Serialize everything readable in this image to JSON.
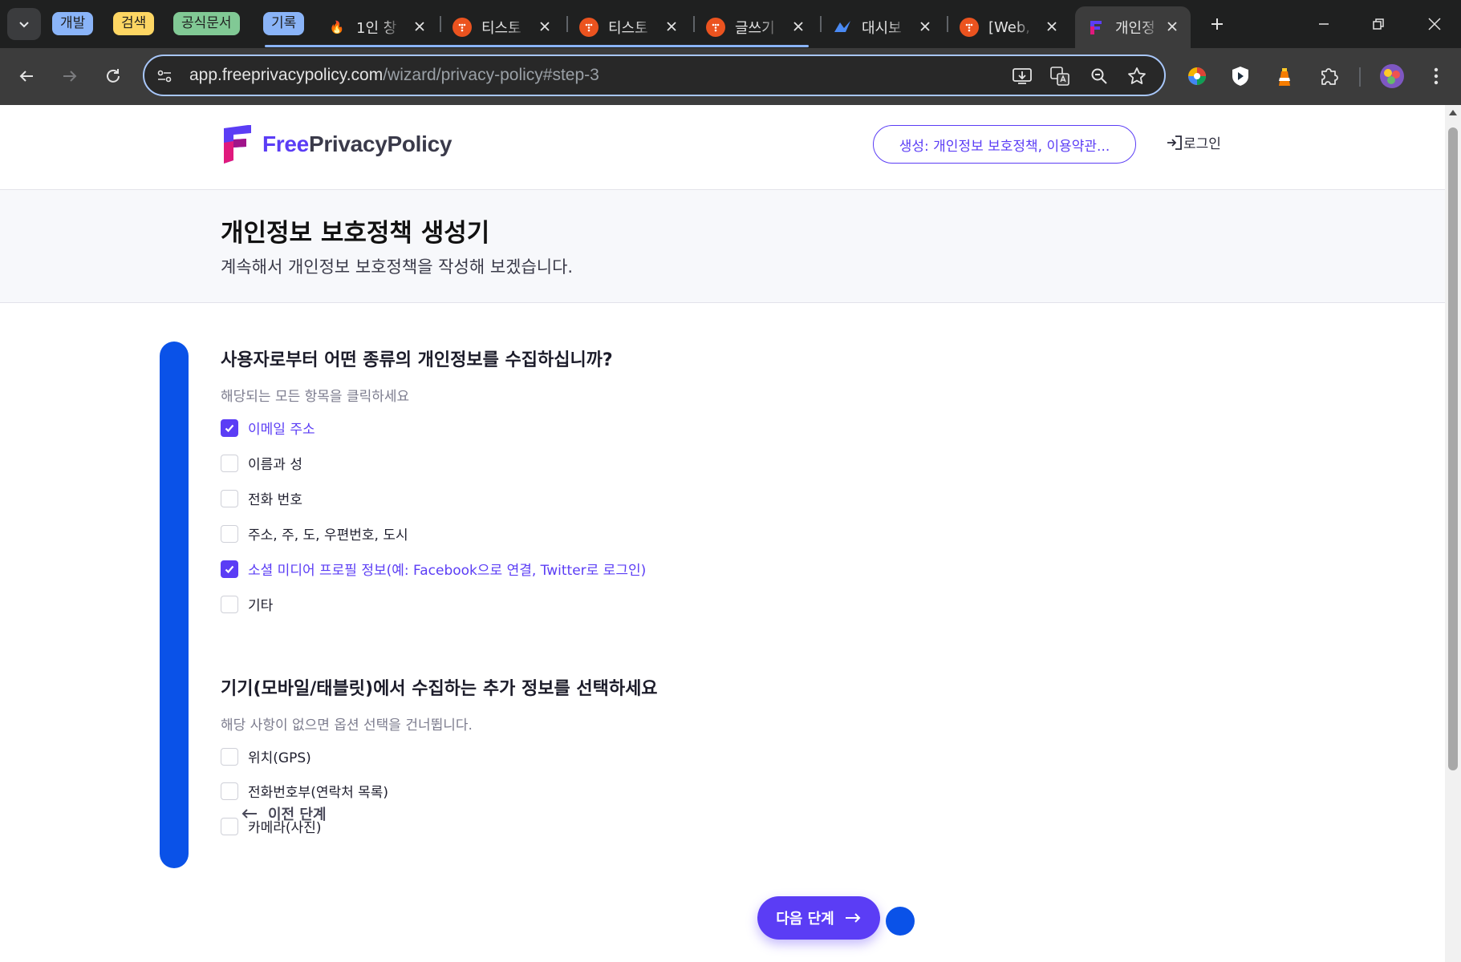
{
  "browser": {
    "groups": [
      {
        "label": "개발",
        "color": "#8ab4f8"
      },
      {
        "label": "검색",
        "color": "#fdd663"
      },
      {
        "label": "공식문서",
        "color": "#81c995"
      },
      {
        "label": "기록",
        "color": "#8ab4f8"
      }
    ],
    "tabs": [
      {
        "title": "1인 창",
        "favicon": "fire-icon"
      },
      {
        "title": "티스토",
        "favicon": "tistory-icon"
      },
      {
        "title": "티스토",
        "favicon": "tistory-icon"
      },
      {
        "title": "글쓰기",
        "favicon": "tistory-icon"
      },
      {
        "title": "대시보",
        "favicon": "dashboard-icon"
      },
      {
        "title": "[Web,",
        "favicon": "tistory-icon"
      },
      {
        "title": "개인정",
        "favicon": "freeprivacypolicy-icon"
      }
    ],
    "url_host": "app.freeprivacypolicy.com",
    "url_path": "/wizard/privacy-policy#step-3"
  },
  "header": {
    "logo_free": "Free",
    "logo_rest": "PrivacyPolicy",
    "cta_label": "생성: 개인정보 보호정책, 이용약관...",
    "login_label": "로그인"
  },
  "hero": {
    "title": "개인정보 보호정책 생성기",
    "subtitle": "계속해서 개인정보 보호정책을 작성해 보겠습니다."
  },
  "section1": {
    "question": "사용자로부터 어떤 종류의 개인정보를 수집하십니까?",
    "hint": "해당되는 모든 항목을 클릭하세요",
    "options": [
      {
        "label": "이메일 주소",
        "checked": true
      },
      {
        "label": "이름과 성",
        "checked": false
      },
      {
        "label": "전화 번호",
        "checked": false
      },
      {
        "label": "주소, 주, 도, 우편번호, 도시",
        "checked": false
      },
      {
        "label": "소셜 미디어 프로필 정보(예: Facebook으로 연결, Twitter로 로그인)",
        "checked": true
      },
      {
        "label": "기타",
        "checked": false
      }
    ]
  },
  "section2": {
    "question": "기기(모바일/태블릿)에서 수집하는 추가 정보를 선택하세요",
    "hint": "해당 사항이 없으면 옵션 선택을 건너뜁니다.",
    "options": [
      {
        "label": "위치(GPS)",
        "checked": false
      },
      {
        "label": "전화번호부(연락처 목록)",
        "checked": false
      },
      {
        "label": "카메라(사진)",
        "checked": false
      }
    ]
  },
  "nav": {
    "prev_label": "이전 단계",
    "next_label": "다음 단계"
  },
  "colors": {
    "accent": "#5b3df5",
    "progress": "#0a52e8"
  }
}
